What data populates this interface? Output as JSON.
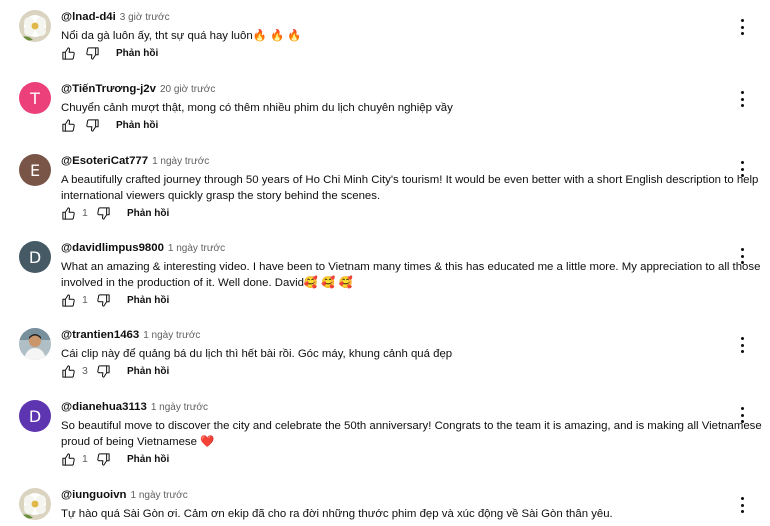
{
  "comments": [
    {
      "author": "@lnad-d4i",
      "time": "3 giờ trước",
      "lines": [
        "Nổi da gà luôn ấy, tht sự quá hay luôn🔥 🔥 🔥"
      ],
      "likes": "",
      "reply_label": "Phản hồi",
      "avatar": {
        "type": "photo",
        "icon": "flower-photo",
        "bg": "#e8e4d8"
      }
    },
    {
      "author": "@TiếnTrương-j2v",
      "time": "20 giờ trước",
      "lines": [
        "Chuyển cảnh mượt thật, mong có thêm nhiều phim du lịch chuyên nghiệp vầy"
      ],
      "likes": "",
      "reply_label": "Phản hồi",
      "avatar": {
        "type": "letter",
        "letter": "T",
        "bg": "#ec407a"
      }
    },
    {
      "author": "@EsoteriCat777",
      "time": "1 ngày trước",
      "lines": [
        "A beautifully crafted journey through 50 years of Ho Chi Minh City's tourism!  It would be even better with a short English description to help",
        "international viewers quickly grasp the story behind the scenes."
      ],
      "likes": "1",
      "reply_label": "Phản hồi",
      "avatar": {
        "type": "letter",
        "letter": "E",
        "bg": "#795548"
      }
    },
    {
      "author": "@davidlimpus9800",
      "time": "1 ngày trước",
      "lines": [
        "What an amazing & interesting video. I have been to Vietnam many times & this has educated me a little more. My appreciation to all those",
        "involved in the production of it. Well done. David🥰 🥰 🥰"
      ],
      "likes": "1",
      "reply_label": "Phản hồi",
      "avatar": {
        "type": "letter",
        "letter": "D",
        "bg": "#455a64"
      }
    },
    {
      "author": "@trantien1463",
      "time": "1 ngày trước",
      "lines": [
        "Cái clip này để quảng bá du lịch thì hết bài rồi. Góc máy, khung cảnh quá đẹp"
      ],
      "likes": "3",
      "reply_label": "Phản hồi",
      "avatar": {
        "type": "photo",
        "icon": "person-photo",
        "bg": "#cfd8dc"
      }
    },
    {
      "author": "@dianehua3113",
      "time": "1 ngày trước",
      "lines": [
        "So beautiful move to discover the city and celebrate the 50th anniversary! Congrats to the team it is amazing, and is making all Vietnamese",
        "proud of being Vietnamese ❤️"
      ],
      "likes": "1",
      "reply_label": "Phản hồi",
      "avatar": {
        "type": "letter",
        "letter": "D",
        "bg": "#5e35b1"
      }
    },
    {
      "author": "@iunguoivn",
      "time": "1 ngày trước",
      "lines": [
        "Tự hào quá Sài Gòn ơi. Cảm ơn ekip đã cho ra đời những thước phim đẹp và xúc động về Sài Gòn thân yêu."
      ],
      "likes": "",
      "reply_label": "",
      "avatar": {
        "type": "photo",
        "icon": "flower-photo",
        "bg": "#eeeeee"
      }
    }
  ],
  "icons": {
    "like": "thumbs-up-icon",
    "dislike": "thumbs-down-icon",
    "menu": "more-vertical-icon"
  }
}
